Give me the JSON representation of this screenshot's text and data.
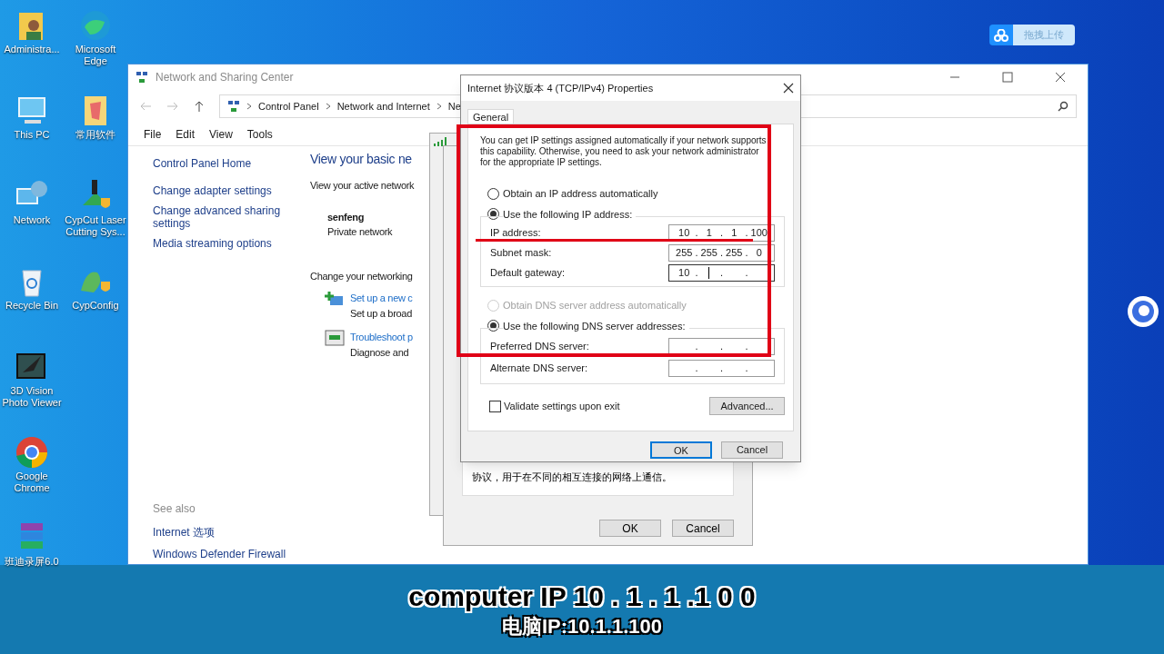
{
  "desktop_columns": [
    [
      {
        "kind": "user",
        "label": "Administra..."
      },
      {
        "kind": "pc",
        "label": "This PC"
      },
      {
        "kind": "network",
        "label": "Network"
      },
      {
        "kind": "bin",
        "label": "Recycle Bin"
      },
      {
        "kind": "viewer",
        "label": "3D Vision Photo Viewer"
      },
      {
        "kind": "chrome",
        "label": "Google Chrome"
      },
      {
        "kind": "archive",
        "label": "班迪录屏6.0"
      }
    ],
    [
      {
        "kind": "edge",
        "label": "Microsoft Edge"
      },
      {
        "kind": "folder",
        "label": "常用软件"
      },
      {
        "kind": "laser",
        "label": "CypCut Laser Cutting Sys..."
      },
      {
        "kind": "config",
        "label": "CypConfig"
      }
    ]
  ],
  "upload_widget": {
    "label": "拖拽上传"
  },
  "explorer": {
    "title": "Network and Sharing Center",
    "breadcrumb": [
      "Control Panel",
      "Network and Internet",
      "Ne"
    ],
    "menu": [
      "File",
      "Edit",
      "View",
      "Tools"
    ],
    "sidebar": {
      "home": "Control Panel Home",
      "links": [
        "Change adapter settings",
        "Change advanced sharing settings",
        "Media streaming options"
      ],
      "see_also": {
        "heading": "See also",
        "links": [
          "Internet 选项",
          "Windows Defender Firewall"
        ]
      }
    },
    "main": {
      "heading": "View your basic ne",
      "active_networks": "View your active network",
      "network_name": "senfeng",
      "network_type": "Private network",
      "change_heading": "Change your networking",
      "tasks": [
        {
          "kind": "setup",
          "link": "Set up a new c",
          "description": "Set up a broad"
        },
        {
          "kind": "troubleshoot",
          "link": "Troubleshoot p",
          "description": "Diagnose and"
        }
      ]
    }
  },
  "ethernet_dialog": {
    "description": "协议，用于在不同的相互连接的网络上通信。",
    "buttons": [
      "OK",
      "Cancel"
    ]
  },
  "ipv4_dialog": {
    "title": "Internet 协议版本 4 (TCP/IPv4) Properties",
    "tabs": [
      {
        "label": "General",
        "selected": true
      }
    ],
    "intro": "You can get IP settings assigned automatically if your network supports this capability. Otherwise, you need to ask your network administrator for the appropriate IP settings.",
    "separator": ".",
    "ip_options": [
      {
        "label": "Obtain an IP address automatically",
        "selected": false,
        "disabled": false
      },
      {
        "label": "Use the following IP address:",
        "selected": true,
        "disabled": false
      }
    ],
    "ip_fields": [
      {
        "label": "IP address:",
        "octets": [
          "10",
          "1",
          "1",
          "100"
        ],
        "focused": false
      },
      {
        "label": "Subnet mask:",
        "octets": [
          "255",
          "255",
          "255",
          "0"
        ],
        "focused": false
      },
      {
        "label": "Default gateway:",
        "octets": [
          "10"
        ],
        "focused": true
      }
    ],
    "dns_options": [
      {
        "label": "Obtain DNS server address automatically",
        "selected": false,
        "disabled": true
      },
      {
        "label": "Use the following DNS server addresses:",
        "selected": true,
        "disabled": false
      }
    ],
    "dns_fields": [
      {
        "label": "Preferred DNS server:",
        "focused": false
      },
      {
        "label": "Alternate DNS server:",
        "focused": false
      }
    ],
    "validate": {
      "label": "Validate settings upon exit",
      "checked": false
    },
    "advanced_button": "Advanced...",
    "buttons": [
      {
        "label": "OK",
        "default": true
      },
      {
        "label": "Cancel",
        "default": false
      }
    ]
  },
  "caption": {
    "english": "computer IP 10 . 1 . 1 .1 0 0",
    "chinese": "电脑IP:10.1.1.100"
  }
}
